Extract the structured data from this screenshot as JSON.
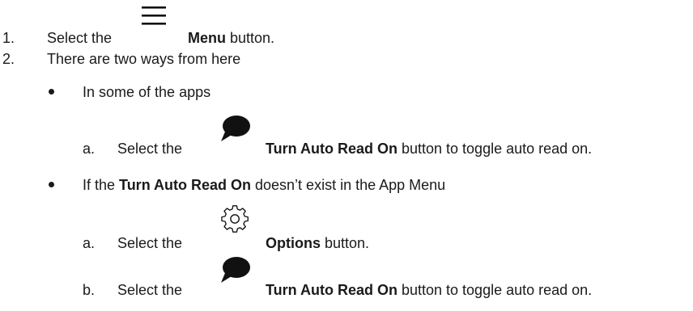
{
  "steps": {
    "s1": {
      "num": "1.",
      "pre": "Select the",
      "bold": "Menu",
      "post": " button."
    },
    "s2": {
      "num": "2.",
      "text": "There are two ways from here"
    }
  },
  "ways": {
    "w1": {
      "text": "In some of the apps",
      "a": {
        "letter": "a.",
        "pre": "Select the",
        "bold": "Turn Auto Read On",
        "post": " button to toggle auto read on."
      }
    },
    "w2": {
      "pre": "If the ",
      "bold": "Turn Auto Read On",
      "post": " doesn’t exist in the App Menu",
      "a": {
        "letter": "a.",
        "pre": "Select the",
        "bold": "Options",
        "post": " button."
      },
      "b": {
        "letter": "b.",
        "pre": "Select the",
        "bold": "Turn Auto Read On",
        "post": " button to toggle auto read on."
      }
    }
  },
  "icons": {
    "menu": "hamburger-menu-icon",
    "speech": "speech-bubble-icon",
    "gear": "gear-icon"
  }
}
